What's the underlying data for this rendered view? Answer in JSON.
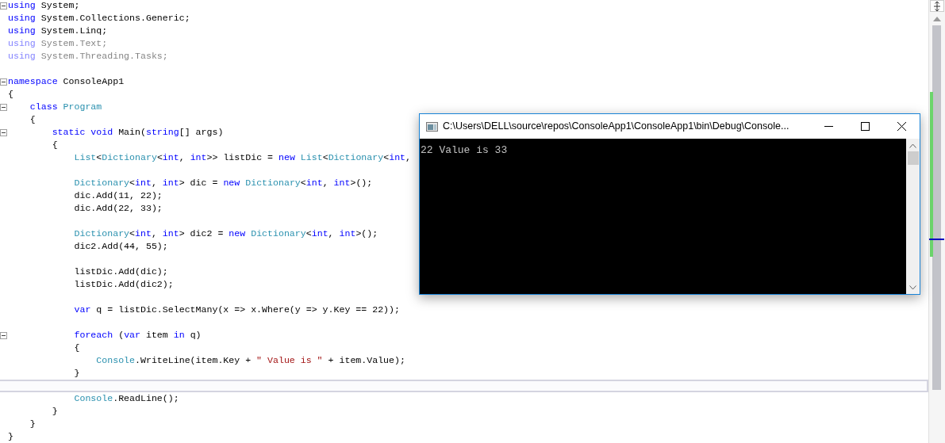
{
  "editor": {
    "lines": [
      {
        "fold": true,
        "faded": false,
        "current": false,
        "tokens": [
          {
            "kind": "keyword",
            "text": "using"
          },
          {
            "kind": "plain",
            "text": " System;"
          }
        ]
      },
      {
        "fold": false,
        "faded": false,
        "current": false,
        "tokens": [
          {
            "kind": "keyword",
            "text": "using"
          },
          {
            "kind": "plain",
            "text": " System.Collections.Generic;"
          }
        ]
      },
      {
        "fold": false,
        "faded": false,
        "current": false,
        "tokens": [
          {
            "kind": "keyword",
            "text": "using"
          },
          {
            "kind": "plain",
            "text": " System.Linq;"
          }
        ]
      },
      {
        "fold": false,
        "faded": true,
        "current": false,
        "tokens": [
          {
            "kind": "keyword",
            "text": "using"
          },
          {
            "kind": "plain",
            "text": " System.Text;"
          }
        ]
      },
      {
        "fold": false,
        "faded": true,
        "current": false,
        "tokens": [
          {
            "kind": "keyword",
            "text": "using"
          },
          {
            "kind": "plain",
            "text": " System.Threading.Tasks;"
          }
        ]
      },
      {
        "fold": false,
        "current": false
      },
      {
        "fold": true,
        "faded": false,
        "current": false,
        "tokens": [
          {
            "kind": "keyword",
            "text": "namespace"
          },
          {
            "kind": "plain",
            "text": " ConsoleApp1"
          }
        ]
      },
      {
        "fold": false,
        "faded": false,
        "current": false,
        "tokens": [
          {
            "kind": "plain",
            "text": "{"
          }
        ]
      },
      {
        "fold": true,
        "faded": false,
        "current": false,
        "tokens": [
          {
            "kind": "keyword",
            "text": "    class "
          },
          {
            "kind": "type",
            "text": "Program"
          }
        ]
      },
      {
        "fold": false,
        "faded": false,
        "current": false,
        "tokens": [
          {
            "kind": "plain",
            "text": "    {"
          }
        ]
      },
      {
        "fold": true,
        "faded": false,
        "current": false,
        "tokens": [
          {
            "kind": "keyword",
            "text": "        static void"
          },
          {
            "kind": "plain",
            "text": " Main("
          },
          {
            "kind": "keyword",
            "text": "string"
          },
          {
            "kind": "plain",
            "text": "[] args)"
          }
        ]
      },
      {
        "fold": false,
        "faded": false,
        "current": false,
        "tokens": [
          {
            "kind": "plain",
            "text": "        {"
          }
        ]
      },
      {
        "fold": false,
        "faded": false,
        "current": false,
        "tokens": [
          {
            "kind": "type",
            "text": "            List"
          },
          {
            "kind": "plain",
            "text": "<"
          },
          {
            "kind": "type",
            "text": "Dictionary"
          },
          {
            "kind": "plain",
            "text": "<"
          },
          {
            "kind": "keyword",
            "text": "int"
          },
          {
            "kind": "plain",
            "text": ", "
          },
          {
            "kind": "keyword",
            "text": "int"
          },
          {
            "kind": "plain",
            "text": ">> listDic = "
          },
          {
            "kind": "keyword",
            "text": "new "
          },
          {
            "kind": "type",
            "text": "List"
          },
          {
            "kind": "plain",
            "text": "<"
          },
          {
            "kind": "type",
            "text": "Dictionary"
          },
          {
            "kind": "plain",
            "text": "<"
          },
          {
            "kind": "keyword",
            "text": "int"
          },
          {
            "kind": "plain",
            "text": ","
          }
        ]
      },
      {
        "fold": false,
        "current": false
      },
      {
        "fold": false,
        "faded": false,
        "current": false,
        "tokens": [
          {
            "kind": "type",
            "text": "            Dictionary"
          },
          {
            "kind": "plain",
            "text": "<"
          },
          {
            "kind": "keyword",
            "text": "int"
          },
          {
            "kind": "plain",
            "text": ", "
          },
          {
            "kind": "keyword",
            "text": "int"
          },
          {
            "kind": "plain",
            "text": "> dic = "
          },
          {
            "kind": "keyword",
            "text": "new "
          },
          {
            "kind": "type",
            "text": "Dictionary"
          },
          {
            "kind": "plain",
            "text": "<"
          },
          {
            "kind": "keyword",
            "text": "int"
          },
          {
            "kind": "plain",
            "text": ", "
          },
          {
            "kind": "keyword",
            "text": "int"
          },
          {
            "kind": "plain",
            "text": ">();"
          }
        ]
      },
      {
        "fold": false,
        "faded": false,
        "current": false,
        "tokens": [
          {
            "kind": "plain",
            "text": "            dic.Add(11, 22);"
          }
        ]
      },
      {
        "fold": false,
        "faded": false,
        "current": false,
        "tokens": [
          {
            "kind": "plain",
            "text": "            dic.Add(22, 33);"
          }
        ]
      },
      {
        "fold": false,
        "current": false
      },
      {
        "fold": false,
        "faded": false,
        "current": false,
        "tokens": [
          {
            "kind": "type",
            "text": "            Dictionary"
          },
          {
            "kind": "plain",
            "text": "<"
          },
          {
            "kind": "keyword",
            "text": "int"
          },
          {
            "kind": "plain",
            "text": ", "
          },
          {
            "kind": "keyword",
            "text": "int"
          },
          {
            "kind": "plain",
            "text": "> dic2 = "
          },
          {
            "kind": "keyword",
            "text": "new "
          },
          {
            "kind": "type",
            "text": "Dictionary"
          },
          {
            "kind": "plain",
            "text": "<"
          },
          {
            "kind": "keyword",
            "text": "int"
          },
          {
            "kind": "plain",
            "text": ", "
          },
          {
            "kind": "keyword",
            "text": "int"
          },
          {
            "kind": "plain",
            "text": ">();"
          }
        ]
      },
      {
        "fold": false,
        "faded": false,
        "current": false,
        "tokens": [
          {
            "kind": "plain",
            "text": "            dic2.Add(44, 55);"
          }
        ]
      },
      {
        "fold": false,
        "current": false
      },
      {
        "fold": false,
        "faded": false,
        "current": false,
        "tokens": [
          {
            "kind": "plain",
            "text": "            listDic.Add(dic);"
          }
        ]
      },
      {
        "fold": false,
        "faded": false,
        "current": false,
        "tokens": [
          {
            "kind": "plain",
            "text": "            listDic.Add(dic2);"
          }
        ]
      },
      {
        "fold": false,
        "current": false
      },
      {
        "fold": false,
        "faded": false,
        "current": false,
        "tokens": [
          {
            "kind": "keyword",
            "text": "            var"
          },
          {
            "kind": "plain",
            "text": " q = listDic.SelectMany(x => x.Where(y => y.Key == 22));"
          }
        ]
      },
      {
        "fold": false,
        "current": false
      },
      {
        "fold": true,
        "faded": false,
        "current": false,
        "tokens": [
          {
            "kind": "keyword",
            "text": "            foreach"
          },
          {
            "kind": "plain",
            "text": " ("
          },
          {
            "kind": "keyword",
            "text": "var"
          },
          {
            "kind": "plain",
            "text": " item "
          },
          {
            "kind": "keyword",
            "text": "in"
          },
          {
            "kind": "plain",
            "text": " q)"
          }
        ]
      },
      {
        "fold": false,
        "faded": false,
        "current": false,
        "tokens": [
          {
            "kind": "plain",
            "text": "            {"
          }
        ]
      },
      {
        "fold": false,
        "faded": false,
        "current": false,
        "tokens": [
          {
            "kind": "type",
            "text": "                Console"
          },
          {
            "kind": "plain",
            "text": ".WriteLine(item.Key + "
          },
          {
            "kind": "string",
            "text": "\" Value is \""
          },
          {
            "kind": "plain",
            "text": " + item.Value);"
          }
        ]
      },
      {
        "fold": false,
        "faded": false,
        "current": false,
        "tokens": [
          {
            "kind": "plain",
            "text": "            }"
          }
        ]
      },
      {
        "fold": false,
        "current": true
      },
      {
        "fold": false,
        "faded": false,
        "current": false,
        "tokens": [
          {
            "kind": "type",
            "text": "            Console"
          },
          {
            "kind": "plain",
            "text": ".ReadLine();"
          }
        ]
      },
      {
        "fold": false,
        "faded": false,
        "current": false,
        "tokens": [
          {
            "kind": "plain",
            "text": "        }"
          }
        ]
      },
      {
        "fold": false,
        "faded": false,
        "current": false,
        "tokens": [
          {
            "kind": "plain",
            "text": "    }"
          }
        ]
      },
      {
        "fold": false,
        "faded": false,
        "current": false,
        "tokens": [
          {
            "kind": "plain",
            "text": "}"
          }
        ]
      }
    ]
  },
  "console_window": {
    "title": "C:\\Users\\DELL\\source\\repos\\ConsoleApp1\\ConsoleApp1\\bin\\Debug\\Console...",
    "output": "22 Value is 33"
  }
}
